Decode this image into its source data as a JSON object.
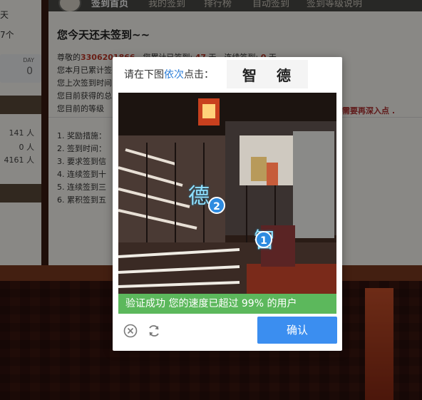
{
  "nav": {
    "items": [
      "签到首页",
      "我的签到",
      "排行榜",
      "自动签到",
      "签到等级说明"
    ]
  },
  "left": {
    "lines": [
      "天",
      "7个"
    ],
    "day_label": "DAY",
    "day_value": "0",
    "counts": [
      "141 人",
      "0 人",
      "4161 人"
    ]
  },
  "main": {
    "title": "您今天还未签到~~",
    "line1_prefix": "尊敬的",
    "username": "3306201866",
    "line1_mid": "，您累计已签到: ",
    "total_days": "47",
    "line1_unit": " 天，连续签到: ",
    "streak_days": "0",
    "line1_end": " 天",
    "lines": [
      "您本月已累计签",
      "您上次签到时间",
      "您目前获得的总",
      "您目前的等级"
    ],
    "warn": "需要再深入点 .",
    "rules": [
      "1. 奖励措施：",
      "2. 签到时间：",
      "3. 要求签到信",
      "4. 连续签到十",
      "5. 连续签到三",
      "6. 累积签到五"
    ]
  },
  "captcha": {
    "prompt_prefix": "请在下图",
    "prompt_emph": "依次",
    "prompt_suffix": "点击：",
    "target_chars": [
      "智",
      "德"
    ],
    "scene_chars": [
      "德",
      "智"
    ],
    "markers": [
      "1",
      "2"
    ],
    "success_text": "验证成功 您的速度已超过 99% 的用户",
    "confirm_label": "确认",
    "close_icon": "close-circle-icon",
    "refresh_icon": "refresh-icon",
    "accent_color": "#3b8ef0",
    "success_color": "#5cb85c"
  }
}
